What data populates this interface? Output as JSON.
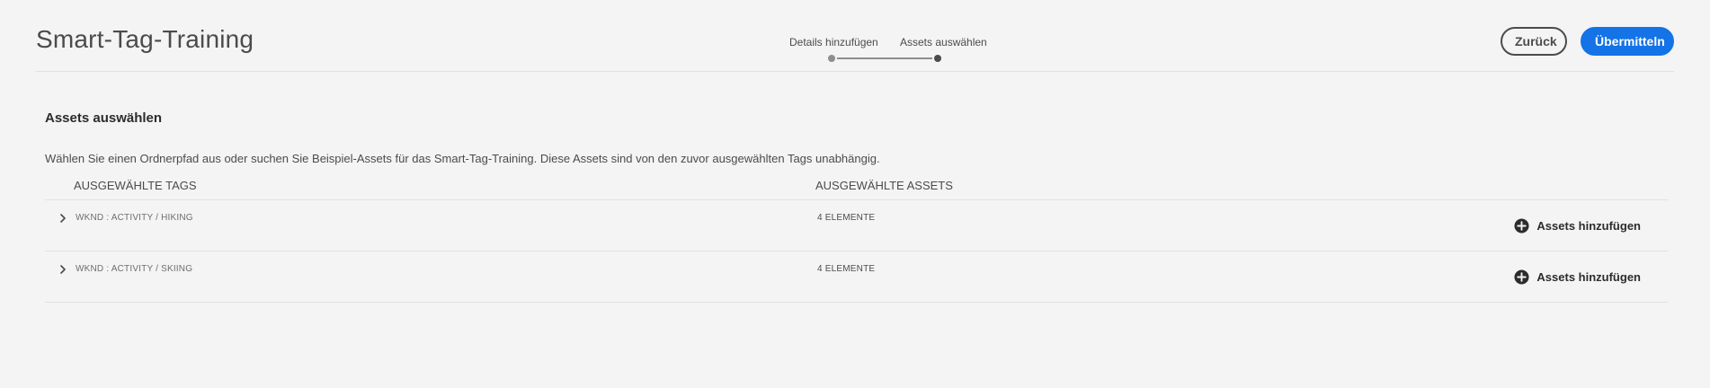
{
  "header": {
    "title": "Smart-Tag-Training",
    "steps": [
      {
        "label": "Details hinzufügen",
        "state": "completed"
      },
      {
        "label": "Assets auswählen",
        "state": "current"
      }
    ],
    "back_label": "Zurück",
    "submit_label": "Übermitteln"
  },
  "main": {
    "section_title": "Assets auswählen",
    "description": "Wählen Sie einen Ordnerpfad aus oder suchen Sie Beispiel-Assets für das Smart-Tag-Training. Diese Assets sind von den zuvor ausgewählten Tags unabhängig.",
    "columns": {
      "tags": "AUSGEWÄHLTE TAGS",
      "assets": "AUSGEWÄHLTE ASSETS"
    },
    "rows": [
      {
        "tag": "WKND : ACTIVITY / HIKING",
        "count": "4 ELEMENTE",
        "action": "Assets hinzufügen"
      },
      {
        "tag": "WKND : ACTIVITY / SKIING",
        "count": "4 ELEMENTE",
        "action": "Assets hinzufügen"
      }
    ]
  },
  "colors": {
    "accent": "#1473e6",
    "background": "#f4f4f4",
    "text": "#2c2c2c"
  },
  "icons": {
    "row_expand": "chevron-right-icon",
    "add": "add-circle-icon"
  }
}
